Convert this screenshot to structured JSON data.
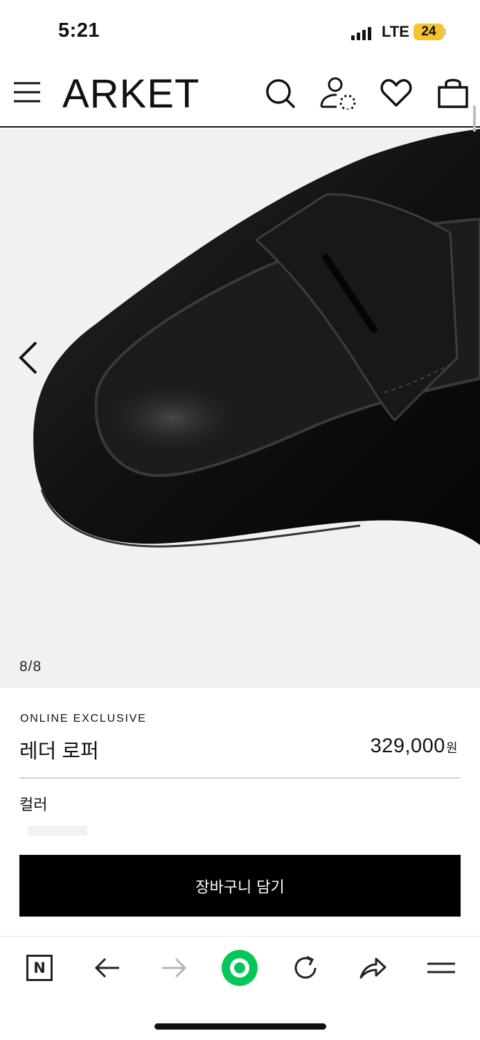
{
  "status_bar": {
    "time": "5:21",
    "network": "LTE",
    "battery": "24",
    "battery_color": "#f4c430"
  },
  "header": {
    "logo": "ARKET",
    "icons": [
      "menu-icon",
      "search-icon",
      "account-icon",
      "heart-icon",
      "bag-icon"
    ]
  },
  "gallery": {
    "counter": "8/8",
    "prev_icon": "chevron-left-icon",
    "current_index": 8,
    "total": 8
  },
  "product": {
    "badge": "ONLINE EXCLUSIVE",
    "name": "레더 로퍼",
    "price": "329,000",
    "currency": "원",
    "color_label": "컬러"
  },
  "actions": {
    "add_to_cart": "장바구니 담기"
  },
  "browser_bar": {
    "home_letter": "N",
    "icons": [
      "naver-home-icon",
      "back-arrow-icon",
      "forward-arrow-icon",
      "green-dot-icon",
      "reload-icon",
      "share-icon",
      "hamburger-icon"
    ],
    "accent": "#03c75a"
  }
}
